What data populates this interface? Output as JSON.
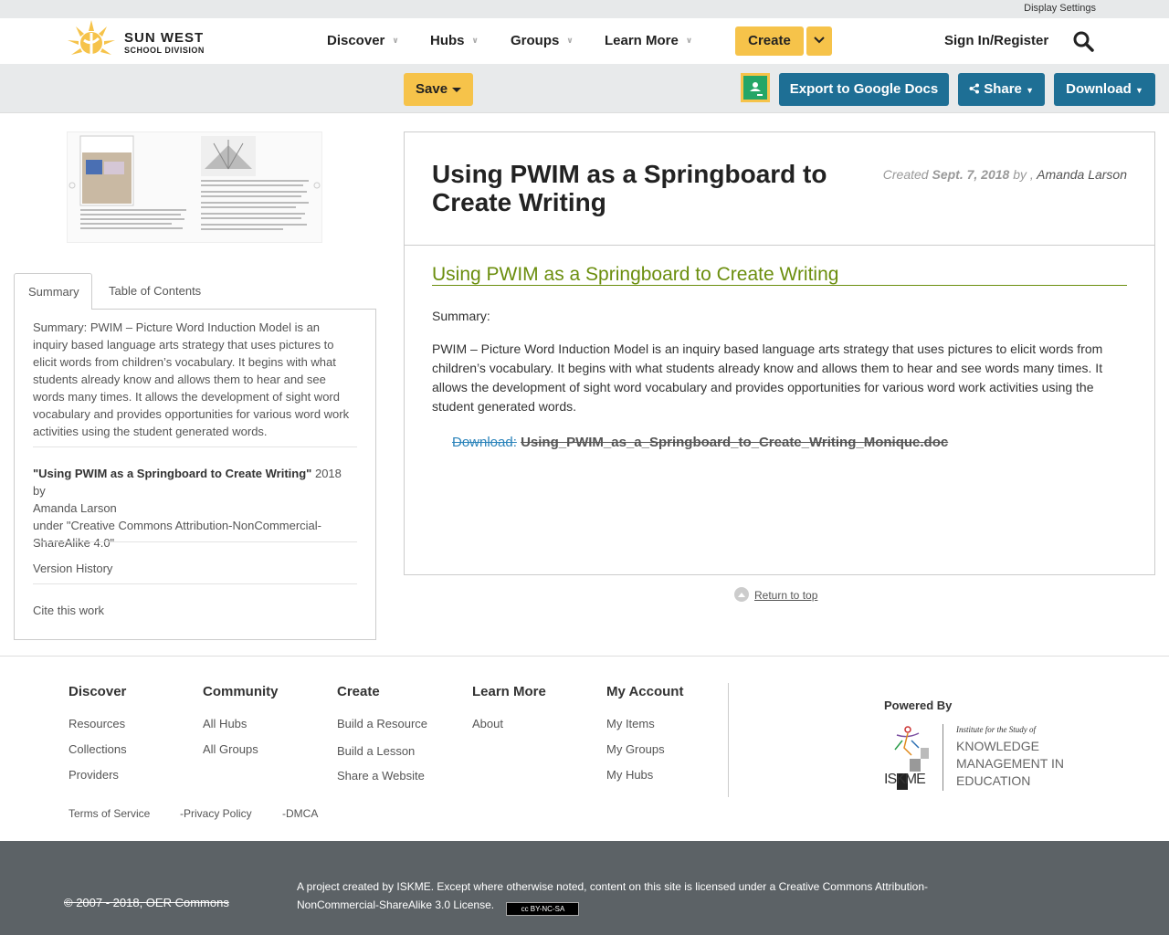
{
  "topbar": {
    "display_settings": "Display Settings"
  },
  "nav": {
    "logo_line1": "SUN WEST",
    "logo_line2": "SCHOOL DIVISION",
    "menu": [
      "Discover",
      "Hubs",
      "Groups",
      "Learn More"
    ],
    "create": "Create",
    "signin": "Sign In/Register"
  },
  "toolbar": {
    "save": "Save",
    "export": "Export to Google Docs",
    "share": "Share",
    "download": "Download"
  },
  "sidebar": {
    "tabs": [
      "Summary",
      "Table of Contents"
    ],
    "summary": "Summary: PWIM – Picture Word Induction Model is an inquiry based language arts strategy that uses pictures to elicit words from children’s vocabulary. It begins with what students already know and allows them to hear and see words many times. It allows the development of sight word vocabulary and provides opportunities for various word work activities using the student generated words.",
    "attrib_title": "\"Using PWIM as a Springboard to Create Writing\"",
    "attrib_year": "2018 by",
    "attrib_author": "Amanda Larson",
    "attrib_license": "under \"Creative Commons Attribution-NonCommercial-ShareAlike 4.0\"",
    "version_history": "Version History",
    "cite": "Cite this work"
  },
  "main": {
    "title": "Using PWIM as a Springboard to Create Writing",
    "created_label": "Created",
    "created_date": "Sept. 7, 2018",
    "by": "by ,",
    "author": "Amanda Larson",
    "subtitle": "Using PWIM as a Springboard to Create Writing",
    "summary_label": "Summary:",
    "description": "PWIM – Picture Word Induction Model is an inquiry based language arts strategy that uses pictures to elicit words from children’s vocabulary.  It begins with what students already know and allows them to hear and see words many times.  It allows the development of sight word vocabulary and provides opportunities for various word work activities using the student generated words.",
    "download_label": "Download:",
    "download_file": "Using_PWIM_as_a_Springboard_to_Create_Writing_Monique.doc",
    "return_top": "Return to top"
  },
  "footer": {
    "discover": {
      "title": "Discover",
      "links": [
        "Resources",
        "Collections",
        "Providers"
      ]
    },
    "community": {
      "title": "Community",
      "links": [
        "All Hubs",
        "All Groups"
      ]
    },
    "create": {
      "title": "Create",
      "links": [
        "Build a Resource",
        "Build a Lesson",
        "Share a Website"
      ]
    },
    "learn": {
      "title": "Learn More",
      "links": [
        "About"
      ]
    },
    "account": {
      "title": "My Account",
      "links": [
        "My Items",
        "My Groups",
        "My Hubs"
      ]
    },
    "powered_by": "Powered By",
    "iskme_line1": "Institute for the Study of",
    "iskme_line2": "KNOWLEDGE",
    "iskme_line3": "MANAGEMENT IN",
    "iskme_line4": "EDUCATION",
    "iskme_mark": "ISKME",
    "terms": "Terms of Service",
    "privacy": "-Privacy Policy",
    "dmca": "-DMCA"
  },
  "bottom": {
    "copyright": "© 2007 - 2018, OER Commons",
    "license": "A project created by ISKME. Except where otherwise noted, content on this site is licensed under a Creative Commons Attribution-NonCommercial-ShareAlike 3.0 License.",
    "cc_badge": "cc BY-NC-SA"
  },
  "colors": {
    "accent_yellow": "#f6c34a",
    "button_blue": "#1e6f95",
    "title_green": "#6b8e0e",
    "link_blue": "#2a83ba",
    "footer_dark": "#5c6266"
  }
}
